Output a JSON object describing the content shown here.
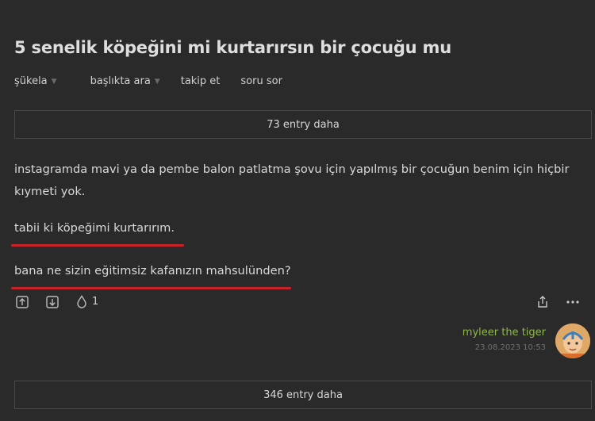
{
  "topic": {
    "title": "5 senelik köpeğini mi kurtarırsın bir çocuğu mu"
  },
  "toolbar": {
    "sort_label": "şükela",
    "search_label": "başlıkta ara",
    "follow_label": "takip et",
    "ask_label": "soru sor"
  },
  "more_above": {
    "label": "73 entry daha"
  },
  "entry": {
    "paragraph1": "instagramda mavi ya da pembe balon patlatma şovu için yapılmış bir çocuğun benim için hiçbir kıymeti yok.",
    "paragraph2": "tabii ki köpeğimi kurtarırım.",
    "paragraph3": "bana ne sizin eğitimsiz kafanızın mahsulünden?",
    "favorite_count": "1",
    "author": "myleer the tiger",
    "date": "23.08.2023 10:53"
  },
  "more_below": {
    "label": "346 entry daha"
  },
  "icons": [
    "upvote-icon",
    "downvote-icon",
    "drop-icon",
    "share-icon",
    "more-icon"
  ],
  "colors": {
    "background": "#2a2a2b",
    "author": "#8fb84a",
    "underline": "#c9232a"
  }
}
